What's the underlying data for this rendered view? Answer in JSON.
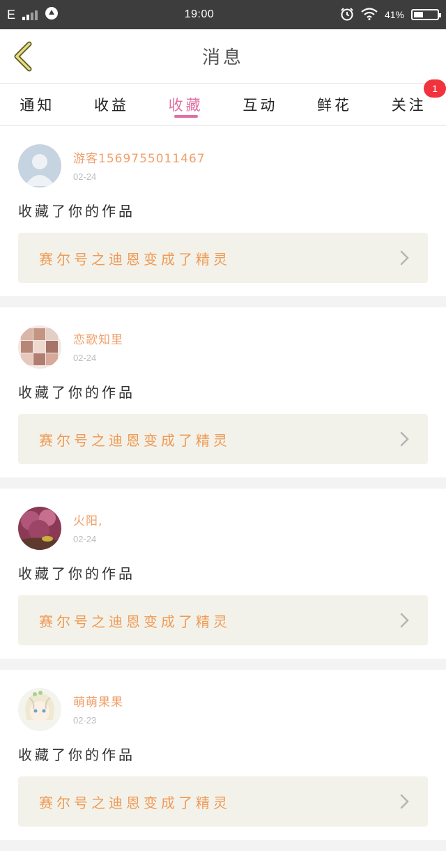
{
  "status_bar": {
    "network": "E",
    "time": "19:00",
    "battery_percent": "41%",
    "battery_level": 0.41
  },
  "header": {
    "title": "消息"
  },
  "tabs": [
    {
      "label": "通知",
      "active": false
    },
    {
      "label": "收益",
      "active": false
    },
    {
      "label": "收藏",
      "active": true
    },
    {
      "label": "互动",
      "active": false
    },
    {
      "label": "鲜花",
      "active": false
    },
    {
      "label": "关注",
      "active": false,
      "badge": "1"
    }
  ],
  "colors": {
    "accent_pink": "#e26fa2",
    "username_orange": "#f0a06a",
    "work_title_orange": "#ef9a55",
    "work_bg": "#f3f2ea",
    "badge_red": "#f0333d"
  },
  "feed": [
    {
      "username": "游客1569755011467",
      "date": "02-24",
      "action": "收藏了你的作品",
      "work_title": "赛尔号之迪恩变成了精灵",
      "avatar": "default-user-avatar"
    },
    {
      "username": "恋歌知里",
      "date": "02-24",
      "action": "收藏了你的作品",
      "work_title": "赛尔号之迪恩变成了精灵",
      "avatar": "anime-collage-avatar"
    },
    {
      "username": "火阳,",
      "date": "02-24",
      "action": "收藏了你的作品",
      "work_title": "赛尔号之迪恩变成了精灵",
      "avatar": "flower-photo-avatar"
    },
    {
      "username": "萌萌果果",
      "date": "02-23",
      "action": "收藏了你的作品",
      "work_title": "赛尔号之迪恩变成了精灵",
      "avatar": "anime-character-avatar"
    }
  ]
}
